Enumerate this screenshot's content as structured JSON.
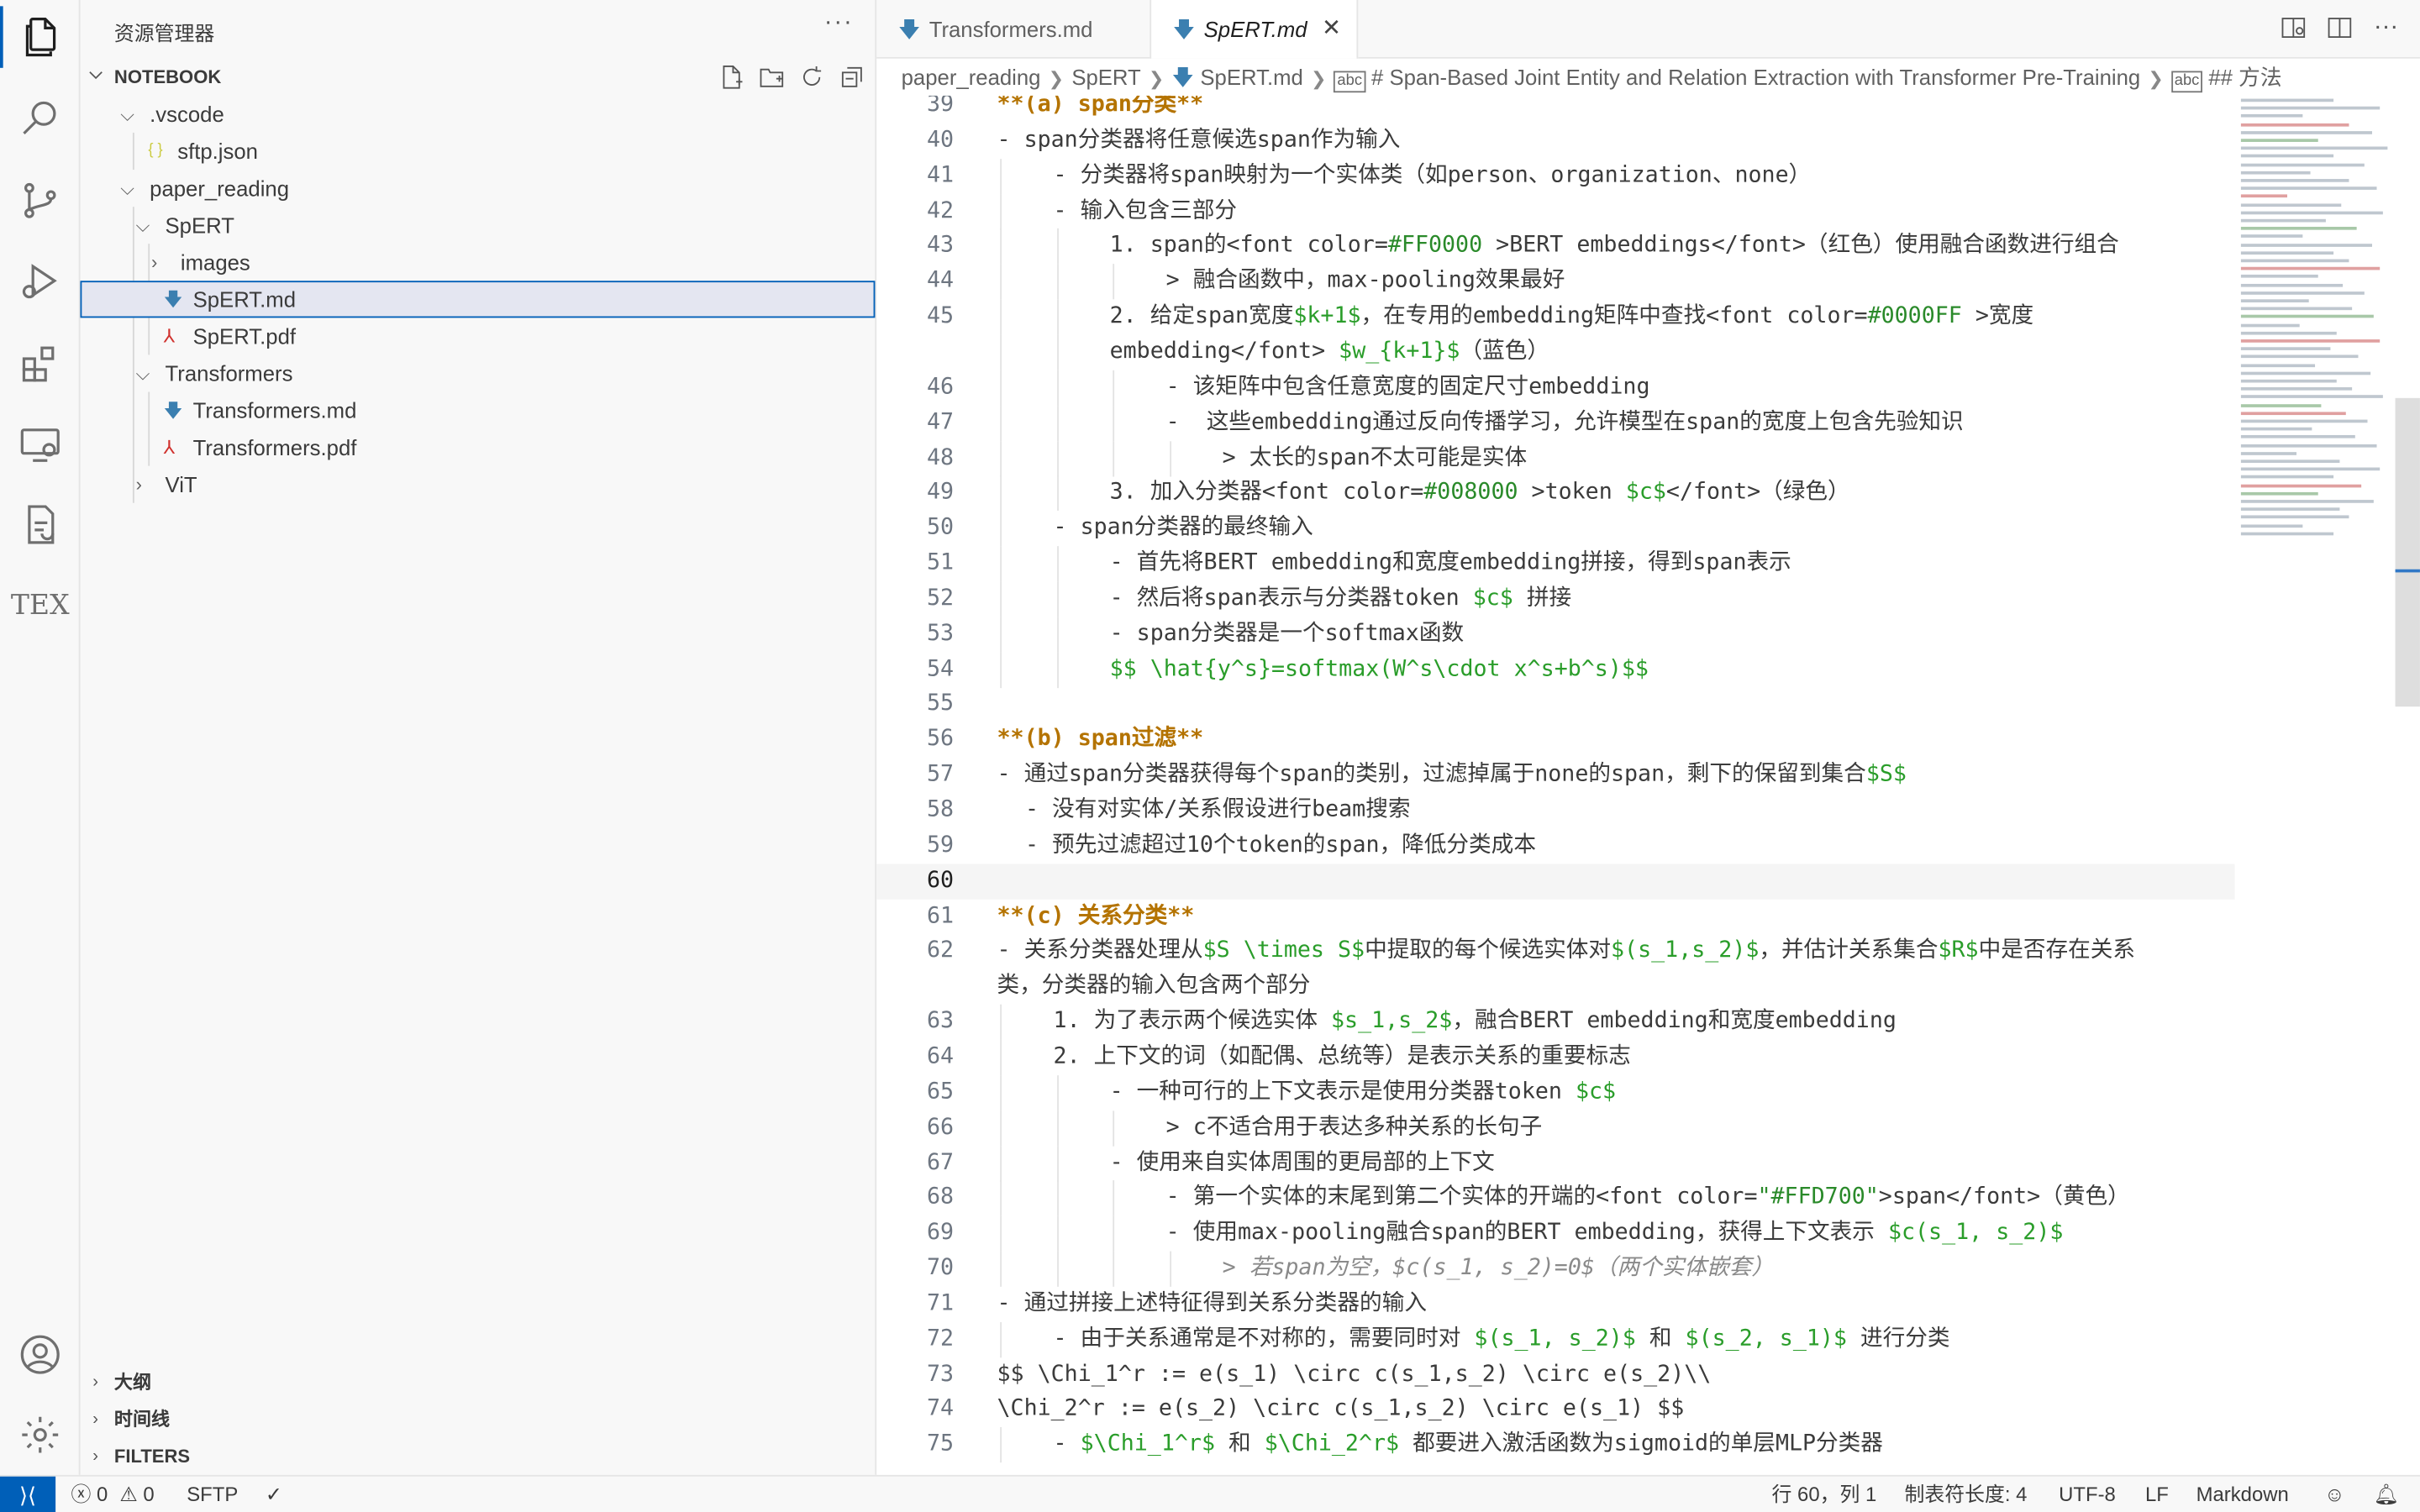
{
  "activity_bar": {
    "items": [
      "explorer-icon",
      "search-icon",
      "source-control-icon",
      "run-debug-icon",
      "extensions-icon",
      "remote-explorer-icon",
      "sftp-icon",
      "tex-icon"
    ],
    "tex_label": "TEX",
    "bottom": [
      "account-icon",
      "settings-gear-icon"
    ]
  },
  "sidebar": {
    "title": "资源管理器",
    "more": "···",
    "section": "NOTEBOOK",
    "tree": [
      {
        "name": ".vscode",
        "type": "folder",
        "open": true,
        "depth": 1
      },
      {
        "name": "sftp.json",
        "type": "json",
        "depth": 2
      },
      {
        "name": "paper_reading",
        "type": "folder",
        "open": true,
        "depth": 1
      },
      {
        "name": "SpERT",
        "type": "folder",
        "open": true,
        "depth": 2
      },
      {
        "name": "images",
        "type": "folder",
        "open": false,
        "depth": 3
      },
      {
        "name": "SpERT.md",
        "type": "md",
        "depth": 3,
        "selected": true
      },
      {
        "name": "SpERT.pdf",
        "type": "pdf",
        "depth": 3
      },
      {
        "name": "Transformers",
        "type": "folder",
        "open": true,
        "depth": 2
      },
      {
        "name": "Transformers.md",
        "type": "md",
        "depth": 3
      },
      {
        "name": "Transformers.pdf",
        "type": "pdf",
        "depth": 3
      },
      {
        "name": "ViT",
        "type": "folder",
        "open": false,
        "depth": 2
      }
    ],
    "panels": [
      "大纲",
      "时间线",
      "FILTERS"
    ]
  },
  "tabs": [
    {
      "label": "Transformers.md",
      "active": false
    },
    {
      "label": "SpERT.md",
      "active": true
    }
  ],
  "breadcrumb": [
    "paper_reading",
    "SpERT",
    "SpERT.md",
    "# Span-Based Joint Entity and Relation Extraction with Transformer Pre-Training",
    "## 方法"
  ],
  "editor": {
    "lines": [
      {
        "n": "39",
        "indent": 0,
        "text": "**(a) span分类**",
        "style": "bold"
      },
      {
        "n": "40",
        "indent": 0,
        "text": "- span分类器将任意候选span作为输入"
      },
      {
        "n": "41",
        "indent": 1,
        "text": "- 分类器将span映射为一个实体类（如person、organization、none）"
      },
      {
        "n": "42",
        "indent": 1,
        "text": "- 输入包含三部分"
      },
      {
        "n": "43",
        "indent": 2,
        "text": "1. span的<font color=#FF0000 >BERT embeddings</font>（红色）使用融合函数进行组合"
      },
      {
        "n": "44",
        "indent": 3,
        "text": "> 融合函数中，max-pooling效果最好"
      },
      {
        "n": "45",
        "indent": 2,
        "text": "2. 给定span宽度$k+1$，在专用的embedding矩阵中查找<font color=#0000FF >宽度"
      },
      {
        "n": "",
        "indent": 2,
        "text": "embedding</font> $w_{k+1}$（蓝色）"
      },
      {
        "n": "46",
        "indent": 3,
        "text": "- 该矩阵中包含任意宽度的固定尺寸embedding"
      },
      {
        "n": "47",
        "indent": 3,
        "text": "-  这些embedding通过反向传播学习，允许模型在span的宽度上包含先验知识"
      },
      {
        "n": "48",
        "indent": 4,
        "text": "> 太长的span不太可能是实体"
      },
      {
        "n": "49",
        "indent": 2,
        "text": "3. 加入分类器<font color=#008000 >token $c$</font>（绿色）"
      },
      {
        "n": "50",
        "indent": 1,
        "text": "- span分类器的最终输入"
      },
      {
        "n": "51",
        "indent": 2,
        "text": "- 首先将BERT embedding和宽度embedding拼接，得到span表示"
      },
      {
        "n": "52",
        "indent": 2,
        "text": "- 然后将span表示与分类器token $c$ 拼接"
      },
      {
        "n": "53",
        "indent": 2,
        "text": "- span分类器是一个softmax函数"
      },
      {
        "n": "54",
        "indent": 2,
        "text": "$$ \\hat{y^s}=softmax(W^s\\cdot x^s+b^s)$$",
        "style": "green"
      },
      {
        "n": "55",
        "indent": 0,
        "text": ""
      },
      {
        "n": "56",
        "indent": 0,
        "text": "**(b) span过滤**",
        "style": "bold"
      },
      {
        "n": "57",
        "indent": 0,
        "text": "- 通过span分类器获得每个span的类别，过滤掉属于none的span，剩下的保留到集合$S$"
      },
      {
        "n": "58",
        "indent": 0.5,
        "text": "- 没有对实体/关系假设进行beam搜索"
      },
      {
        "n": "59",
        "indent": 0.5,
        "text": "- 预先过滤超过10个token的span，降低分类成本"
      },
      {
        "n": "60",
        "indent": 0,
        "text": "",
        "current": true
      },
      {
        "n": "61",
        "indent": 0,
        "text": "**(c) 关系分类**",
        "style": "bold"
      },
      {
        "n": "62",
        "indent": 0,
        "text": "- 关系分类器处理从$S \\times S$中提取的每个候选实体对$(s_1,s_2)$，并估计关系集合$R$中是否存在关系"
      },
      {
        "n": "",
        "indent": 0,
        "text": "类，分类器的输入包含两个部分"
      },
      {
        "n": "63",
        "indent": 1,
        "text": "1. 为了表示两个候选实体 $s_1,s_2$，融合BERT embedding和宽度embedding"
      },
      {
        "n": "64",
        "indent": 1,
        "text": "2. 上下文的词（如配偶、总统等）是表示关系的重要标志"
      },
      {
        "n": "65",
        "indent": 2,
        "text": "- 一种可行的上下文表示是使用分类器token $c$"
      },
      {
        "n": "66",
        "indent": 3,
        "text": "> c不适合用于表达多种关系的长句子"
      },
      {
        "n": "67",
        "indent": 2,
        "text": "- 使用来自实体周围的更局部的上下文"
      },
      {
        "n": "68",
        "indent": 3,
        "text": "- 第一个实体的末尾到第二个实体的开端的<font color=\"#FFD700\">span</font>（黄色）"
      },
      {
        "n": "69",
        "indent": 3,
        "text": "- 使用max-pooling融合span的BERT embedding，获得上下文表示 $c(s_1, s_2)$"
      },
      {
        "n": "70",
        "indent": 4,
        "text": "> 若span为空，$c(s_1, s_2)=0$（两个实体嵌套）",
        "style": "grey"
      },
      {
        "n": "71",
        "indent": 0,
        "text": "- 通过拼接上述特征得到关系分类器的输入"
      },
      {
        "n": "72",
        "indent": 1,
        "text": "- 由于关系通常是不对称的，需要同时对 $(s_1, s_2)$ 和 $(s_2, s_1)$ 进行分类"
      },
      {
        "n": "73",
        "indent": 0,
        "text": "$$ \\Chi_1^r := e(s_1) \\circ c(s_1,s_2) \\circ e(s_2)\\\\"
      },
      {
        "n": "74",
        "indent": 0,
        "text": "\\Chi_2^r := e(s_2) \\circ c(s_1,s_2) \\circ e(s_1) $$"
      },
      {
        "n": "75",
        "indent": 1,
        "text": "- $\\Chi_1^r$ 和 $\\Chi_2^r$ 都要进入激活函数为sigmoid的单层MLP分类器"
      }
    ]
  },
  "statusbar": {
    "remote_icon": "remote-icon",
    "errors": "0",
    "warnings": "0",
    "sftp": "SFTP",
    "check": "✓",
    "position": "行 60，列 1",
    "tab_size": "制表符长度: 4",
    "encoding": "UTF-8",
    "eol": "LF",
    "language": "Markdown"
  },
  "colors": {
    "accent": "#005fb8",
    "md_icon": "#3b7fb0",
    "pdf_icon": "#d0312d",
    "json_icon": "#cbcb41",
    "heading_bold": "#b47300",
    "math_green": "#2a9d2a"
  }
}
